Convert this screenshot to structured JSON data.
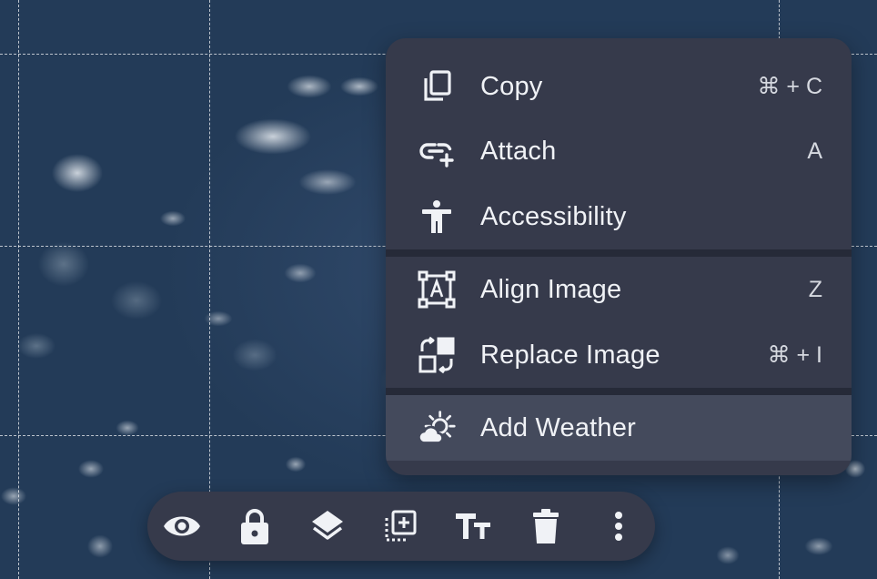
{
  "context_menu": {
    "items": [
      {
        "label": "Copy",
        "shortcut": "⌘ + C",
        "icon": "copy-icon"
      },
      {
        "label": "Attach",
        "shortcut": "A",
        "icon": "attach-link-icon"
      },
      {
        "label": "Accessibility",
        "shortcut": "",
        "icon": "accessibility-icon"
      },
      {
        "label": "Align Image",
        "shortcut": "Z",
        "icon": "align-image-icon"
      },
      {
        "label": "Replace Image",
        "shortcut": "⌘ + I",
        "icon": "replace-image-icon"
      },
      {
        "label": "Add Weather",
        "shortcut": "",
        "icon": "weather-icon"
      }
    ],
    "hovered_item": "Add Weather"
  },
  "toolbar": {
    "tools": [
      {
        "name": "preview",
        "icon": "eye-icon"
      },
      {
        "name": "lock",
        "icon": "lock-icon"
      },
      {
        "name": "layers",
        "icon": "layers-icon"
      },
      {
        "name": "duplicate",
        "icon": "add-frame-icon"
      },
      {
        "name": "text",
        "icon": "text-size-icon"
      },
      {
        "name": "delete",
        "icon": "trash-icon"
      },
      {
        "name": "more",
        "icon": "more-vertical-icon"
      }
    ]
  },
  "colors": {
    "menu_bg": "#363a4b",
    "menu_hover": "#444a5c",
    "divider": "#262a38",
    "canvas_bg": "#2d4563",
    "text": "#f0f2f6"
  }
}
